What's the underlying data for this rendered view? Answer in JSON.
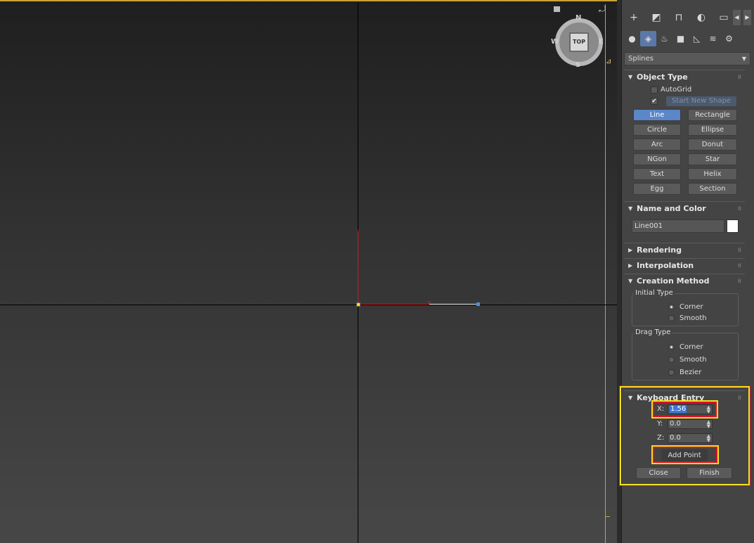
{
  "viewport": {
    "cube_face": "TOP",
    "compass": {
      "n": "N",
      "s": "S",
      "e": "E",
      "w": "W"
    },
    "axis_labels": {
      "x": "x",
      "y": "y"
    }
  },
  "command_panel": {
    "tabs": [
      {
        "icon": "create-icon",
        "glyph": "+"
      },
      {
        "icon": "modify-icon",
        "glyph": "◩"
      },
      {
        "icon": "hierarchy-icon",
        "glyph": "⊓"
      },
      {
        "icon": "motion-icon",
        "glyph": "◐"
      },
      {
        "icon": "display-icon",
        "glyph": "▭"
      }
    ],
    "categories": [
      {
        "icon": "geometry-icon",
        "glyph": "●"
      },
      {
        "icon": "shapes-icon",
        "glyph": "◈"
      },
      {
        "icon": "lights-icon",
        "glyph": "♨"
      },
      {
        "icon": "cameras-icon",
        "glyph": "■"
      },
      {
        "icon": "helpers-icon",
        "glyph": "◺"
      },
      {
        "icon": "spacewarps-icon",
        "glyph": "≋"
      },
      {
        "icon": "systems-icon",
        "glyph": "⚙"
      }
    ],
    "dropdown_value": "Splines"
  },
  "object_type": {
    "title": "Object Type",
    "autogrid_label": "AutoGrid",
    "start_new_shape_label": "Start New Shape",
    "buttons": [
      "Line",
      "Rectangle",
      "Circle",
      "Ellipse",
      "Arc",
      "Donut",
      "NGon",
      "Star",
      "Text",
      "Helix",
      "Egg",
      "Section"
    ]
  },
  "name_and_color": {
    "title": "Name and Color",
    "name_value": "Line001",
    "color": "#ffffff"
  },
  "rendering": {
    "title": "Rendering"
  },
  "interpolation": {
    "title": "Interpolation"
  },
  "creation_method": {
    "title": "Creation Method",
    "initial_type": {
      "title": "Initial Type",
      "options": [
        "Corner",
        "Smooth"
      ],
      "selected": "Corner"
    },
    "drag_type": {
      "title": "Drag Type",
      "options": [
        "Corner",
        "Smooth",
        "Bezier"
      ],
      "selected": "Corner"
    }
  },
  "keyboard_entry": {
    "title": "Keyboard Entry",
    "x_label": "X:",
    "x_value": "1.56",
    "y_label": "Y:",
    "y_value": "0.0",
    "z_label": "Z:",
    "z_value": "0.0",
    "add_point_label": "Add Point",
    "close_label": "Close",
    "finish_label": "Finish"
  },
  "colors": {
    "accent": "#5b86c8",
    "highlight_red": "#e0102a",
    "highlight_yellow": "#f0e020",
    "viewport_frame": "#c8a23a"
  }
}
